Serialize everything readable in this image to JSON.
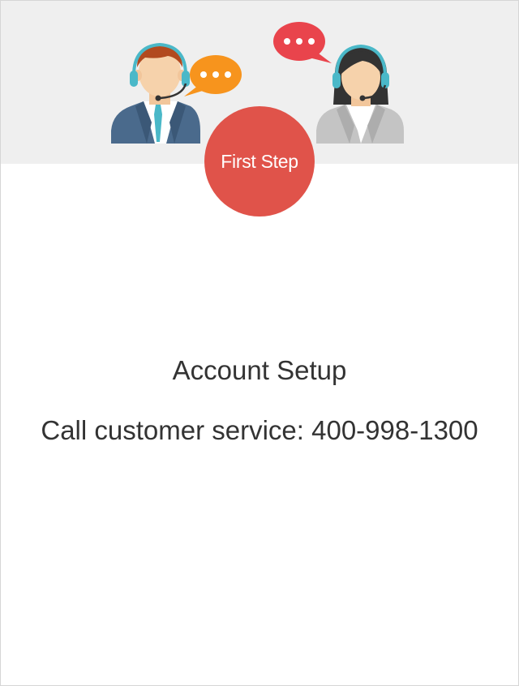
{
  "step_badge": {
    "label": "First Step",
    "color": "#e0534a"
  },
  "content": {
    "title": "Account Setup",
    "subtitle": "Call customer service: 400-998-1300"
  },
  "illustration": {
    "left_agent_icon": "male-support-agent-icon",
    "right_agent_icon": "female-support-agent-icon",
    "left_bubble_color": "#f7941d",
    "right_bubble_color": "#e9444c"
  }
}
